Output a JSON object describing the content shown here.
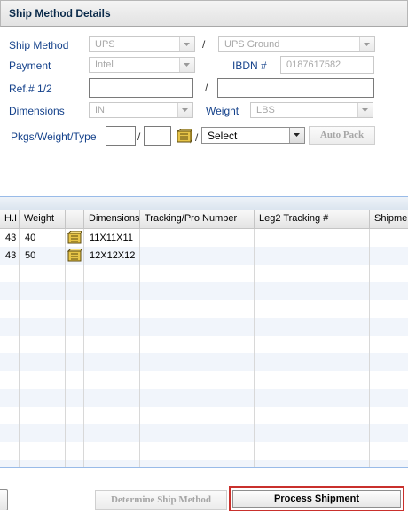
{
  "header": {
    "title": "Ship Method Details"
  },
  "form": {
    "ship_method_label": "Ship Method",
    "ship_method_value": "UPS",
    "ship_service_value": "UPS Ground",
    "payment_label": "Payment",
    "payment_value": "Intel",
    "ibdn_label": "IBDN #",
    "ibdn_value": "0187617582",
    "ref_label": "Ref.# 1/2",
    "dimensions_label": "Dimensions",
    "dimensions_value": "IN",
    "weight_label": "Weight",
    "weight_value": "LBS",
    "pkgs_label": "Pkgs/Weight/Type",
    "type_value": "Select",
    "auto_pack_label": "Auto Pack",
    "slash": "/"
  },
  "grid": {
    "columns": [
      "H.I",
      "Weight",
      "",
      "Dimensions",
      "Tracking/Pro Number",
      "Leg2 Tracking #",
      "Shipme"
    ],
    "rows": [
      {
        "hi": "43",
        "weight": "40",
        "dimensions": "11X11X11",
        "tracking": "",
        "leg2": "",
        "ship": ""
      },
      {
        "hi": "43",
        "weight": "50",
        "dimensions": "12X12X12",
        "tracking": "",
        "leg2": "",
        "ship": ""
      }
    ]
  },
  "footer": {
    "determine_label": "Determine Ship Method",
    "process_label": "Process Shipment"
  },
  "icons": [
    "dropdown-arrow-icon",
    "package-icon"
  ],
  "colors": {
    "label": "#15428b",
    "highlight_border": "#c9302c",
    "grid_border": "#99bbe8"
  }
}
